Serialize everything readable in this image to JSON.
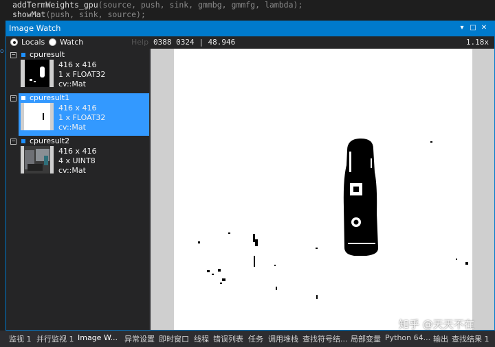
{
  "code": {
    "line1": {
      "fn": "addTermWeights_gpu",
      "args": "(source, push, sink, gmmbg, gmmfg, lambda);"
    },
    "line2": {
      "fn": "showMat",
      "args": "(push, sink, source);"
    }
  },
  "window": {
    "title": "Image Watch",
    "controls": [
      "▾",
      "□",
      "✕"
    ]
  },
  "toolbar": {
    "locals_label": "Locals",
    "watch_label": "Watch",
    "help_label": "Help",
    "pixel_info": "0388 0324 | 48.946",
    "zoom": "1.18x"
  },
  "items": [
    {
      "name": "cpuresult",
      "size": "416 x 416",
      "type": "1 x FLOAT32",
      "kind": "cv::Mat",
      "selected": false
    },
    {
      "name": "cpuresult1",
      "size": "416 x 416",
      "type": "1 x FLOAT32",
      "kind": "cv::Mat",
      "selected": true
    },
    {
      "name": "cpuresult2",
      "size": "416 x 416",
      "type": "4 x UINT8",
      "kind": "cv::Mat",
      "selected": false
    }
  ],
  "tabs": [
    "监视 1",
    "并行监视 1",
    "Image W...",
    "异常设置",
    "即时窗口",
    "线程",
    "错误列表",
    "任务",
    "调用堆栈",
    "查找符号结...",
    "局部变量",
    "Python 64...",
    "输出",
    "查找结果 1"
  ],
  "active_tab": "Image W...",
  "watermark": "知乎 @天天不在"
}
